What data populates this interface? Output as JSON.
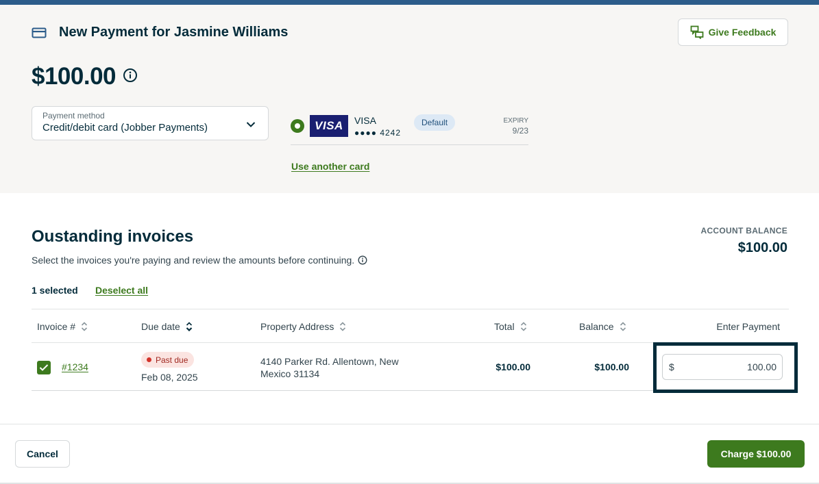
{
  "header": {
    "title": "New Payment for Jasmine Williams",
    "card_icon": "credit-card-icon",
    "amount": "$100.00",
    "amount_info_icon": "info-icon",
    "feedback_button": "Give Feedback",
    "feedback_icon": "feedback-chat-icon"
  },
  "payment_method": {
    "label": "Payment method",
    "value": "Credit/debit card (Jobber Payments)",
    "chevron_icon": "chevron-down-icon"
  },
  "card": {
    "logo_text": "VISA",
    "brand": "VISA",
    "masked_number": "●●●● 4242",
    "default_badge": "Default",
    "expiry_label": "EXPIRY",
    "expiry_value": "9/23",
    "use_another": "Use another card"
  },
  "invoices": {
    "title": "Oustanding invoices",
    "subtitle": "Select the invoices you're paying and review the amounts before continuing.",
    "account_balance_label": "ACCOUNT BALANCE",
    "account_balance_value": "$100.00",
    "selected_count": "1 selected",
    "deselect_all": "Deselect all",
    "columns": {
      "invoice": "Invoice #",
      "due_date": "Due date",
      "address": "Property Address",
      "total": "Total",
      "balance": "Balance",
      "payment": "Enter Payment"
    },
    "rows": [
      {
        "checked": true,
        "invoice_number": "#1234",
        "status": "Past due",
        "due_date": "Feb 08, 2025",
        "address": "4140 Parker Rd. Allentown, New Mexico 31134",
        "total": "$100.00",
        "balance": "$100.00",
        "currency": "$",
        "payment": "100.00"
      }
    ]
  },
  "footer": {
    "cancel": "Cancel",
    "charge": "Charge $100.00"
  },
  "colors": {
    "accent_green": "#3d7a1e",
    "navy": "#032b3a",
    "top_bar": "#2c5c8a",
    "past_due_red": "#d2332b"
  }
}
